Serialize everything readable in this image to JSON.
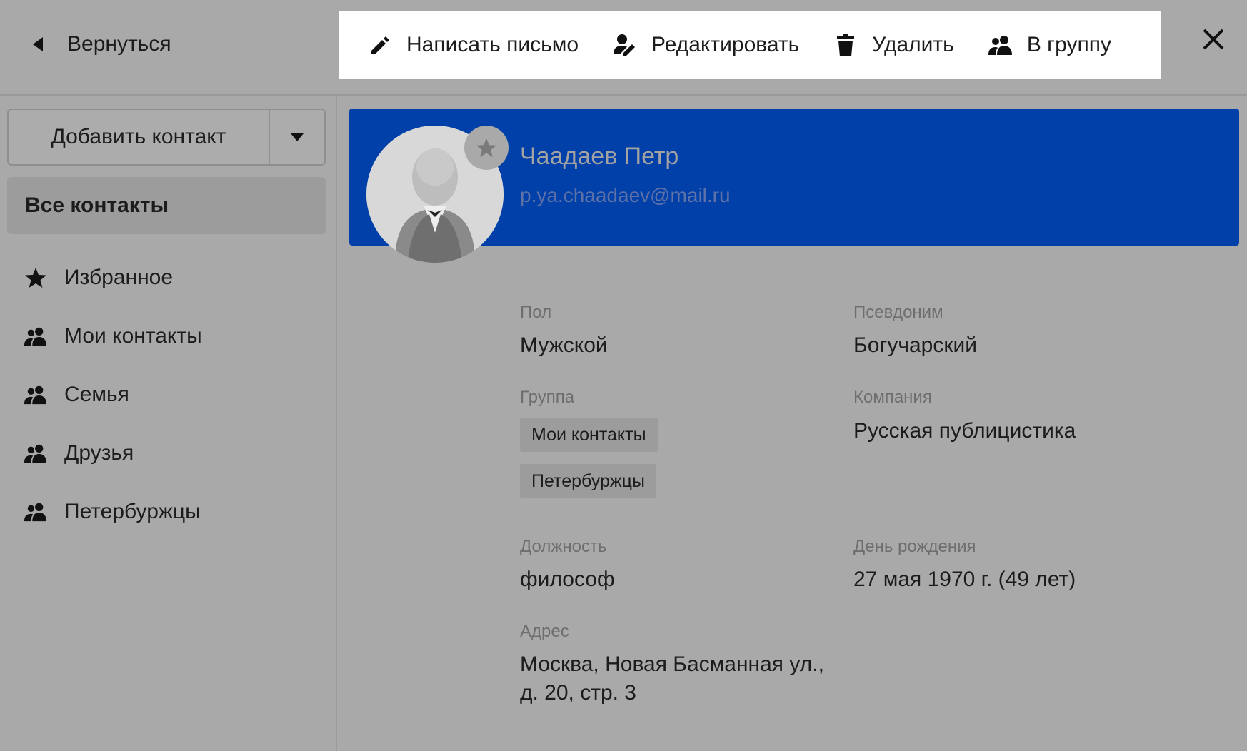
{
  "topbar": {
    "back_label": "Вернуться",
    "actions": [
      {
        "label": "Написать письмо",
        "icon": "pencil-icon"
      },
      {
        "label": "Редактировать",
        "icon": "user-edit-icon"
      },
      {
        "label": "Удалить",
        "icon": "trash-icon"
      },
      {
        "label": "В группу",
        "icon": "users-icon"
      }
    ],
    "close_icon": "close-icon"
  },
  "sidebar": {
    "add_contact_label": "Добавить контакт",
    "all_contacts_label": "Все контакты",
    "items": [
      {
        "label": "Избранное",
        "icon": "star-icon"
      },
      {
        "label": "Мои контакты",
        "icon": "users-icon"
      },
      {
        "label": "Семья",
        "icon": "users-icon"
      },
      {
        "label": "Друзья",
        "icon": "users-icon"
      },
      {
        "label": "Петербуржцы",
        "icon": "users-icon"
      }
    ]
  },
  "contact": {
    "name": "Чаадаев Петр",
    "email": "p.ya.chaadaev@mail.ru",
    "fields": {
      "gender_label": "Пол",
      "gender": "Мужской",
      "nickname_label": "Псевдоним",
      "nickname": "Богучарский",
      "group_label": "Группа",
      "groups": [
        "Мои контакты",
        "Петербуржцы"
      ],
      "company_label": "Компания",
      "company": "Русская публицистика",
      "position_label": "Должность",
      "position": "философ",
      "birthday_label": "День рождения",
      "birthday": "27 мая 1970 г. (49 лет)",
      "address_label": "Адрес",
      "address_line1": "Москва, Новая Басманная ул.,",
      "address_line2": "д. 20, стр. 3"
    }
  },
  "colors": {
    "header_bg": "#0040a8",
    "overlay_bg": "#a9a9a9",
    "toolbar_bg": "#ffffff"
  }
}
